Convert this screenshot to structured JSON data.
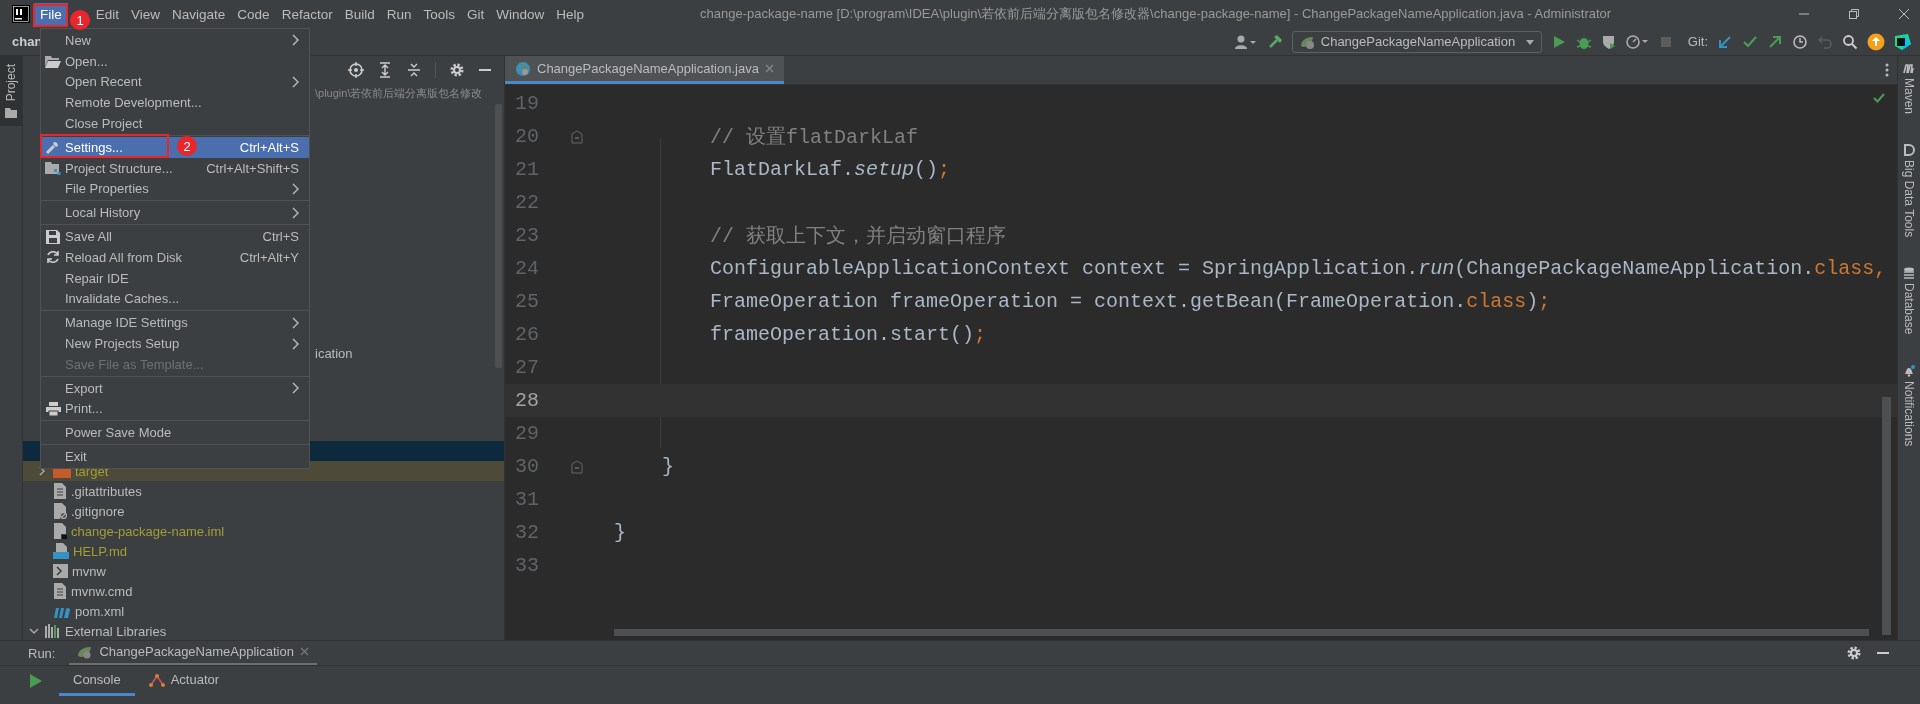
{
  "title_bar": {
    "menus": [
      {
        "label": "File",
        "selected": true
      },
      {
        "label": "Edit",
        "selected": false
      },
      {
        "label": "View",
        "selected": false
      },
      {
        "label": "Navigate",
        "selected": false
      },
      {
        "label": "Code",
        "selected": false
      },
      {
        "label": "Refactor",
        "selected": false
      },
      {
        "label": "Build",
        "selected": false
      },
      {
        "label": "Run",
        "selected": false
      },
      {
        "label": "Tools",
        "selected": false
      },
      {
        "label": "Git",
        "selected": false
      },
      {
        "label": "Window",
        "selected": false
      },
      {
        "label": "Help",
        "selected": false
      }
    ],
    "title": "change-package-name [D:\\program\\IDEA\\plugin\\若依前后端分离版包名修改器\\change-package-name] - ChangePackageNameApplication.java - Administrator"
  },
  "toolbar": {
    "project_name": "chan",
    "run_config": "ChangePackageNameApplication",
    "git_label": "Git:"
  },
  "file_menu": {
    "groups": [
      [
        {
          "label": "New",
          "submenu": true,
          "disabled": false,
          "selected": false
        },
        {
          "label": "Open...",
          "submenu": false,
          "disabled": false,
          "selected": false
        },
        {
          "label": "Open Recent",
          "submenu": true,
          "disabled": false,
          "selected": false
        },
        {
          "label": "Remote Development...",
          "submenu": false,
          "disabled": false,
          "selected": false
        },
        {
          "label": "Close Project",
          "submenu": false,
          "disabled": false,
          "selected": false
        }
      ],
      [
        {
          "label": "Settings...",
          "shortcut": "Ctrl+Alt+S",
          "submenu": false,
          "disabled": false,
          "selected": true
        },
        {
          "label": "Project Structure...",
          "shortcut": "Ctrl+Alt+Shift+S",
          "submenu": false,
          "disabled": false,
          "selected": false
        },
        {
          "label": "File Properties",
          "submenu": true,
          "disabled": false,
          "selected": false
        }
      ],
      [
        {
          "label": "Local History",
          "submenu": true,
          "disabled": false,
          "selected": false
        }
      ],
      [
        {
          "label": "Save All",
          "shortcut": "Ctrl+S",
          "submenu": false,
          "disabled": false,
          "selected": false
        },
        {
          "label": "Reload All from Disk",
          "shortcut": "Ctrl+Alt+Y",
          "submenu": false,
          "disabled": false,
          "selected": false
        },
        {
          "label": "Repair IDE",
          "submenu": false,
          "disabled": false,
          "selected": false
        },
        {
          "label": "Invalidate Caches...",
          "submenu": false,
          "disabled": false,
          "selected": false
        }
      ],
      [
        {
          "label": "Manage IDE Settings",
          "submenu": true,
          "disabled": false,
          "selected": false
        },
        {
          "label": "New Projects Setup",
          "submenu": true,
          "disabled": false,
          "selected": false
        },
        {
          "label": "Save File as Template...",
          "submenu": false,
          "disabled": true,
          "selected": false
        }
      ],
      [
        {
          "label": "Export",
          "submenu": true,
          "disabled": false,
          "selected": false
        },
        {
          "label": "Print...",
          "submenu": false,
          "disabled": false,
          "selected": false
        }
      ],
      [
        {
          "label": "Power Save Mode",
          "submenu": false,
          "disabled": false,
          "selected": false
        }
      ],
      [
        {
          "label": "Exit",
          "submenu": false,
          "disabled": false,
          "selected": false
        }
      ]
    ]
  },
  "annotations": [
    {
      "label": "1"
    },
    {
      "label": "2"
    }
  ],
  "left_stripe": [
    {
      "label": "Project",
      "selected": true
    }
  ],
  "project_panel": {
    "path_hint": "\\plugin\\若依前后端分离版包名修改",
    "tree": [
      {
        "children": [
          {
            "kind": "partial",
            "label": "ication",
            "selected": false,
            "highlighted": false,
            "color": "#bbbbbb"
          },
          {
            "kind": "hidden",
            "selected": true,
            "highlighted": false
          },
          {
            "kind": "folder",
            "label": "target",
            "expanded": false,
            "selected": false,
            "highlighted": true,
            "color": "#a39e34"
          },
          {
            "kind": "file",
            "label": ".gitattributes",
            "selected": false,
            "highlighted": false,
            "color": "#bbbbbb"
          },
          {
            "kind": "gitignore",
            "label": ".gitignore",
            "selected": false,
            "highlighted": false,
            "color": "#bbbbbb"
          },
          {
            "kind": "module",
            "label": "change-package-name.iml",
            "selected": false,
            "highlighted": false,
            "color": "#a39e34"
          },
          {
            "kind": "markdown",
            "label": "HELP.md",
            "selected": false,
            "highlighted": false,
            "color": "#a39e34"
          },
          {
            "kind": "script",
            "label": "mvnw",
            "selected": false,
            "highlighted": false,
            "color": "#bbbbbb"
          },
          {
            "kind": "file",
            "label": "mvnw.cmd",
            "selected": false,
            "highlighted": false,
            "color": "#bbbbbb"
          },
          {
            "kind": "maven",
            "label": "pom.xml",
            "selected": false,
            "highlighted": false,
            "color": "#bbbbbb"
          }
        ]
      },
      {
        "kind": "library",
        "label": "External Libraries",
        "expanded": true,
        "selected": false,
        "highlighted": false,
        "color": "#bbbbbb"
      }
    ]
  },
  "editor": {
    "tab": {
      "label": "ChangePackageNameApplication.java",
      "selected": true
    },
    "lines": [
      {
        "number": "19",
        "current": false
      },
      {
        "number": "20",
        "current": false,
        "fold": true,
        "tokens": [
          {
            "text": "        // 设置flatDarkLaf",
            "kind": "comment"
          }
        ]
      },
      {
        "number": "21",
        "current": false,
        "tokens": [
          {
            "text": "        FlatDarkLaf.",
            "kind": "plain"
          },
          {
            "text": "setup",
            "kind": "italic"
          },
          {
            "text": "()",
            "kind": "plain"
          },
          {
            "text": ";",
            "kind": "punct"
          }
        ]
      },
      {
        "number": "22",
        "current": false
      },
      {
        "number": "23",
        "current": false,
        "tokens": [
          {
            "text": "        // 获取上下文，并启动窗口程序",
            "kind": "comment"
          }
        ]
      },
      {
        "number": "24",
        "current": false,
        "tokens": [
          {
            "text": "        ConfigurableApplicationContext context = SpringApplication.",
            "kind": "plain"
          },
          {
            "text": "run",
            "kind": "italic"
          },
          {
            "text": "(ChangePackageNameApplication.",
            "kind": "plain"
          },
          {
            "text": "class",
            "kind": "keyword"
          },
          {
            "text": ",",
            "kind": "punct"
          }
        ]
      },
      {
        "number": "25",
        "current": false,
        "tokens": [
          {
            "text": "        FrameOperation frameOperation = context.getBean(FrameOperation.",
            "kind": "plain"
          },
          {
            "text": "class",
            "kind": "keyword"
          },
          {
            "text": ")",
            "kind": "plain"
          },
          {
            "text": ";",
            "kind": "punct"
          }
        ]
      },
      {
        "number": "26",
        "current": false,
        "tokens": [
          {
            "text": "        frameOperation.start()",
            "kind": "plain"
          },
          {
            "text": ";",
            "kind": "punct"
          }
        ]
      },
      {
        "number": "27",
        "current": false
      },
      {
        "number": "28",
        "current": true
      },
      {
        "number": "29",
        "current": false
      },
      {
        "number": "30",
        "current": false,
        "fold": true,
        "tokens": [
          {
            "text": "    }",
            "kind": "plain"
          }
        ]
      },
      {
        "number": "31",
        "current": false
      },
      {
        "number": "32",
        "current": false,
        "tokens": [
          {
            "text": "}",
            "kind": "plain"
          }
        ]
      },
      {
        "number": "33",
        "current": false
      }
    ]
  },
  "right_stripe": [
    {
      "label": "Maven"
    },
    {
      "label": "Big Data Tools"
    },
    {
      "label": "Database"
    },
    {
      "label": "Notifications"
    }
  ],
  "run_panel": {
    "label": "Run:",
    "tab": "ChangePackageNameApplication",
    "subtabs": [
      {
        "label": "Console",
        "selected": true
      },
      {
        "label": "Actuator",
        "selected": false
      }
    ]
  }
}
